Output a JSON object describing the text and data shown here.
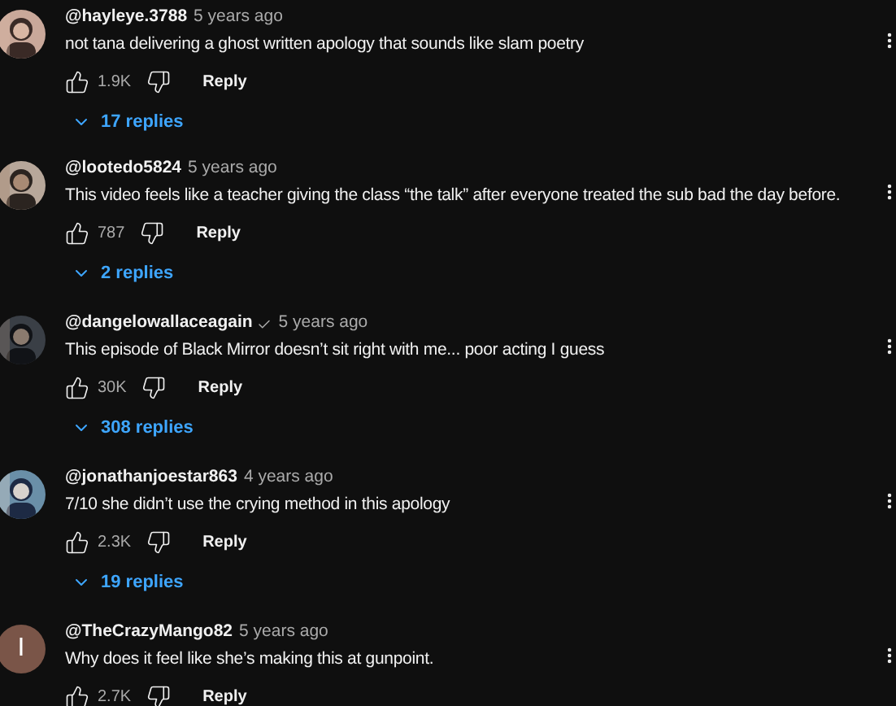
{
  "comments": [
    {
      "author": "@hayleye.3788",
      "verified": false,
      "time": "5 years ago",
      "text": "not tana delivering a ghost written apology that sounds like slam poetry",
      "likes": "1.9K",
      "reply_label": "Reply",
      "replies": "17 replies"
    },
    {
      "author": "@lootedo5824",
      "verified": false,
      "time": "5 years ago",
      "text": "This video feels like a teacher giving the class “the talk” after everyone treated the sub bad the day before.",
      "likes": "787",
      "reply_label": "Reply",
      "replies": "2 replies"
    },
    {
      "author": "@dangelowallaceagain",
      "verified": true,
      "time": "5 years ago",
      "text": "This episode of Black Mirror doesn’t sit right with me... poor acting I guess",
      "likes": "30K",
      "reply_label": "Reply",
      "replies": "308 replies"
    },
    {
      "author": "@jonathanjoestar863",
      "verified": false,
      "time": "4 years ago",
      "text": "7/10 she didn’t use the crying method in this apology",
      "likes": "2.3K",
      "reply_label": "Reply",
      "replies": "19 replies"
    },
    {
      "avatar": {
        "kind": "letter",
        "letter": "I",
        "color": "#7a5548"
      },
      "author": "@TheCrazyMango82",
      "verified": false,
      "time": "5 years ago",
      "text": "Why does it feel like she’s making this at gunpoint.",
      "likes": "2.7K",
      "reply_label": "Reply"
    }
  ]
}
